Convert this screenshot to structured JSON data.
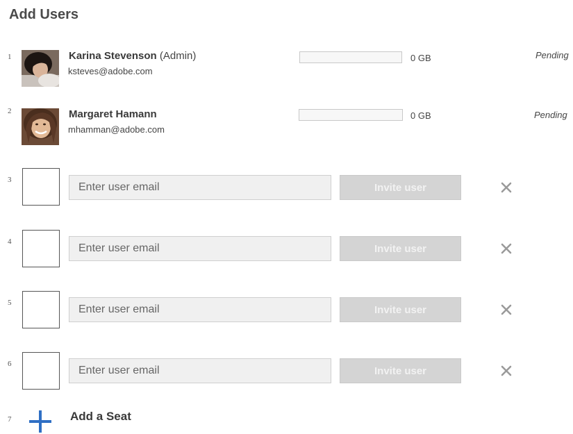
{
  "page": {
    "title": "Add Users"
  },
  "users": [
    {
      "num": "1",
      "name": "Karina Stevenson",
      "role": "(Admin)",
      "email": "ksteves@adobe.com",
      "storage_label": "0 GB",
      "storage_fraction": 0,
      "status": "Pending"
    },
    {
      "num": "2",
      "name": "Margaret Hamann",
      "role": "",
      "email": "mhamman@adobe.com",
      "storage_label": "0 GB",
      "storage_fraction": 0,
      "status": "Pending"
    }
  ],
  "seats": [
    {
      "num": "3",
      "placeholder": "Enter user email",
      "invite_label": "Invite user"
    },
    {
      "num": "4",
      "placeholder": "Enter user email",
      "invite_label": "Invite user"
    },
    {
      "num": "5",
      "placeholder": "Enter user email",
      "invite_label": "Invite user"
    },
    {
      "num": "6",
      "placeholder": "Enter user email",
      "invite_label": "Invite user"
    }
  ],
  "add_seat": {
    "num": "7",
    "label": "Add a Seat",
    "icon": "plus-icon"
  },
  "colors": {
    "accent": "#2f6fc4",
    "invite_disabled": "#d4d4d4",
    "remove_icon": "#9a9a9a"
  }
}
